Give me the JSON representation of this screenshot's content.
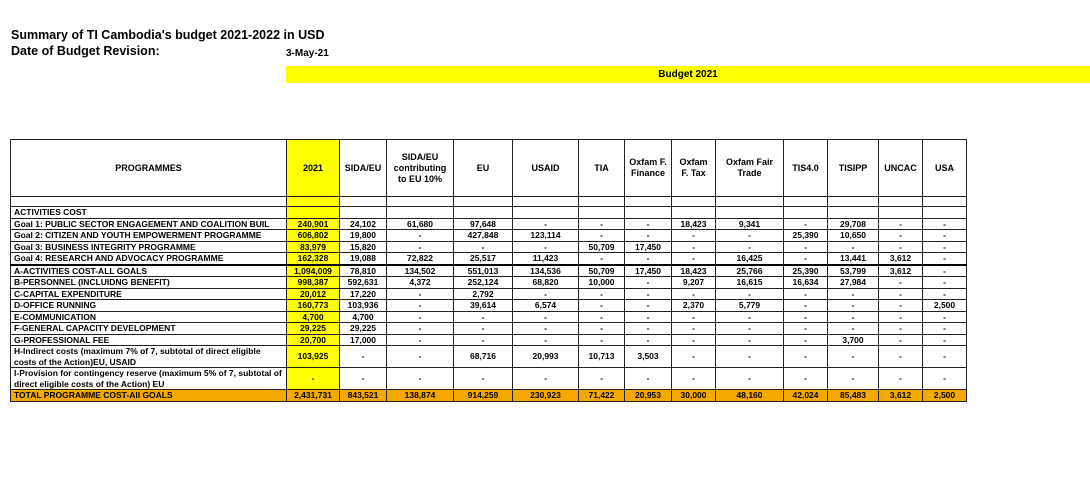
{
  "header": {
    "title": "Summary of TI Cambodia's budget 2021-2022 in USD",
    "revision_label": "Date of Budget Revision:",
    "revision_date": "3-May-21",
    "budget_band": "Budget 2021"
  },
  "table": {
    "columns": [
      "PROGRAMMES",
      "2021",
      "SIDA/EU",
      "SIDA/EU contributing to EU 10%",
      "EU",
      "USAID",
      "TIA",
      "Oxfam F. Finance",
      "Oxfam F. Tax",
      "Oxfam Fair Trade",
      "TIS4.0",
      "TISIPP",
      "UNCAC",
      "USA"
    ],
    "section_label": "ACTIVITIES COST",
    "goal_rows": [
      {
        "label": "Goal 1: PUBLIC SECTOR ENGAGEMENT AND COALITION BUIL",
        "values": [
          "240,901",
          "24,102",
          "61,680",
          "97,648",
          "-",
          "-",
          "-",
          "18,423",
          "9,341",
          "-",
          "29,708",
          "-",
          "-"
        ]
      },
      {
        "label": "Goal 2: CITIZEN AND YOUTH EMPOWERMENT PROGRAMME",
        "values": [
          "606,802",
          "19,800",
          "-",
          "427,848",
          "123,114",
          "-",
          "-",
          "-",
          "-",
          "25,390",
          "10,650",
          "-",
          "-"
        ]
      },
      {
        "label": "Goal 3: BUSINESS INTEGRITY PROGRAMME",
        "values": [
          "83,979",
          "15,820",
          "-",
          "-",
          "-",
          "50,709",
          "17,450",
          "-",
          "-",
          "-",
          "-",
          "-",
          "-"
        ]
      },
      {
        "label": "Goal 4: RESEARCH AND ADVOCACY PROGRAMME",
        "values": [
          "162,328",
          "19,088",
          "72,822",
          "25,517",
          "11,423",
          "-",
          "-",
          "-",
          "16,425",
          "-",
          "13,441",
          "3,612",
          "-"
        ]
      }
    ],
    "cost_rows": [
      {
        "label": "A-ACTIVITIES COST-ALL GOALS",
        "values": [
          "1,094,009",
          "78,810",
          "134,502",
          "551,013",
          "134,536",
          "50,709",
          "17,450",
          "18,423",
          "25,766",
          "25,390",
          "53,799",
          "3,612",
          "-"
        ]
      },
      {
        "label": "B-PERSONNEL (INCLUIDNG BENEFIT)",
        "values": [
          "998,387",
          "592,631",
          "4,372",
          "252,124",
          "68,820",
          "10,000",
          "-",
          "9,207",
          "16,615",
          "16,634",
          "27,984",
          "-",
          "-"
        ]
      },
      {
        "label": "C-CAPITAL EXPENDITURE",
        "values": [
          "20,012",
          "17,220",
          "-",
          "2,792",
          "-",
          "-",
          "-",
          "-",
          "-",
          "-",
          "-",
          "-",
          "-"
        ]
      },
      {
        "label": "D-OFFICE RUNNING",
        "values": [
          "160,773",
          "103,936",
          "-",
          "39,614",
          "6,574",
          "-",
          "-",
          "2,370",
          "5,779",
          "-",
          "-",
          "-",
          "2,500"
        ]
      },
      {
        "label": "E-COMMUNICATION",
        "values": [
          "4,700",
          "4,700",
          "-",
          "-",
          "-",
          "-",
          "-",
          "-",
          "-",
          "-",
          "-",
          "-",
          "-"
        ]
      },
      {
        "label": "F-GENERAL CAPACITY DEVELOPMENT",
        "values": [
          "29,225",
          "29,225",
          "-",
          "-",
          "-",
          "-",
          "-",
          "-",
          "-",
          "-",
          "-",
          "-",
          "-"
        ]
      },
      {
        "label": "G-PROFESSIONAL FEE",
        "values": [
          "20,700",
          "17,000",
          "-",
          "-",
          "-",
          "-",
          "-",
          "-",
          "-",
          "-",
          "3,700",
          "-",
          "-"
        ]
      }
    ],
    "indirect_row": {
      "label": "H-Indirect costs (maximum 7% of 7, subtotal of direct eligible costs of the Action)EU, USAID",
      "values": [
        "103,925",
        "-",
        "-",
        "68,716",
        "20,993",
        "10,713",
        "3,503",
        "-",
        "-",
        "-",
        "-",
        "-",
        "-"
      ]
    },
    "contingency_row": {
      "label": "I-Provision for contingency reserve (maximum 5% of 7, subtotal of direct eligible costs of the Action) EU",
      "values": [
        "-",
        "-",
        "-",
        "-",
        "-",
        "-",
        "-",
        "-",
        "-",
        "-",
        "-",
        "-",
        "-"
      ]
    },
    "total_row": {
      "label": "TOTAL PROGRAMME COST-All GOALS",
      "values": [
        "2,431,731",
        "843,521",
        "138,874",
        "914,259",
        "230,923",
        "71,422",
        "20,953",
        "30,000",
        "48,160",
        "42,024",
        "85,483",
        "3,612",
        "2,500"
      ]
    }
  }
}
